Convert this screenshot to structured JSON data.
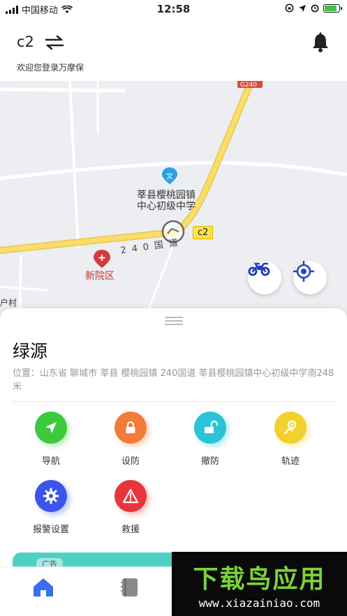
{
  "status_bar": {
    "carrier": "中国移动",
    "time": "12:58",
    "battery_level": 0.85
  },
  "header": {
    "vehicle_name": "c2",
    "welcome_text": "欢迎您登录万摩保"
  },
  "map": {
    "poi_school": "莘县樱桃园镇\n中心初级中学",
    "poi_district": "新院区",
    "road_name": "240国道",
    "road_sign": "G240",
    "village_fragment": "户村",
    "car_tag": "c2"
  },
  "sheet": {
    "device_name": "绿源",
    "location": "位置：山东省 聊城市 莘县 樱桃园镇 240国道 莘县樱桃园镇中心初级中学南248米",
    "actions": [
      {
        "label": "导航",
        "icon": "navigate-icon",
        "color": "#3cc93b"
      },
      {
        "label": "设防",
        "icon": "lock-icon",
        "color": "#f37b3a"
      },
      {
        "label": "撤防",
        "icon": "unlock-icon",
        "color": "#2cc3d6"
      },
      {
        "label": "轨迹",
        "icon": "track-icon",
        "color": "#f3d12c"
      },
      {
        "label": "报警设置",
        "icon": "gear-icon",
        "color": "#3a55e8"
      },
      {
        "label": "救援",
        "icon": "warning-icon",
        "color": "#e8353b"
      }
    ],
    "ad_label": "广告"
  },
  "tabbar": {
    "tabs": [
      {
        "name": "home",
        "icon": "home-icon",
        "color": "#3a6ef0"
      },
      {
        "name": "record",
        "icon": "notebook-icon",
        "color": "#888888"
      }
    ]
  },
  "watermark": {
    "title": "下载鸟应用",
    "url": "www.xiazainiao.com"
  }
}
